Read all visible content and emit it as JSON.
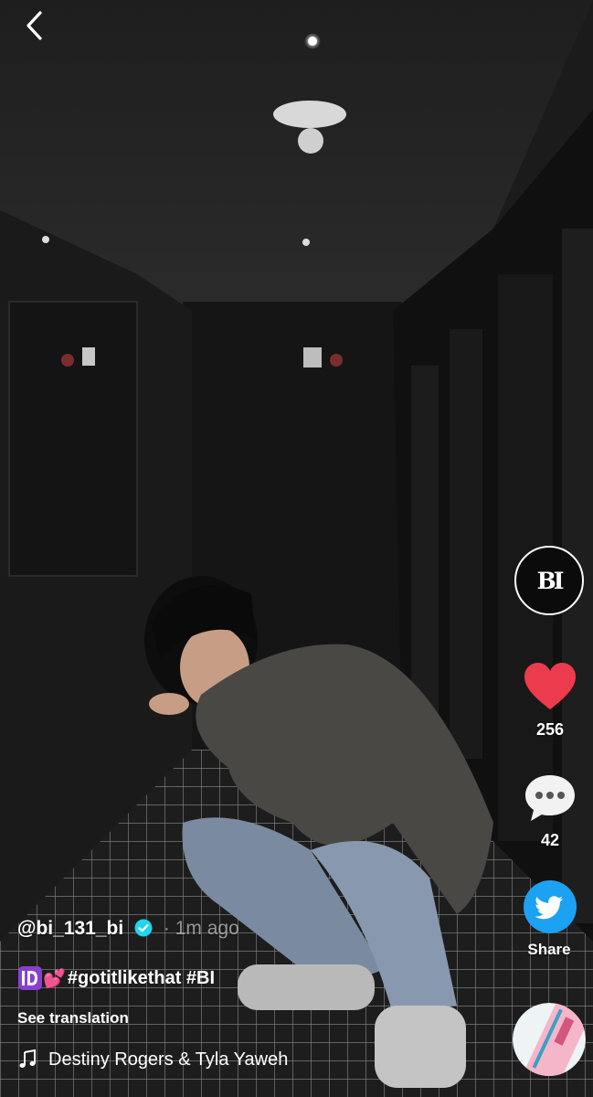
{
  "post": {
    "username": "@bi_131_bi",
    "time": "· 1m ago",
    "caption_emoji": "💕",
    "caption_tags": "#gotitlikethat #BI",
    "see_translation": "See translation",
    "music": "Destiny Rogers & Tyla Yaweh"
  },
  "sidebar": {
    "avatar_text": "BI",
    "likes": "256",
    "comments": "42",
    "share_label": "Share"
  },
  "icons": {
    "back": "chevron-left-icon",
    "verified": "verified-badge-icon",
    "id": "id-emoji-icon",
    "like": "heart-icon",
    "comment": "comment-bubble-icon",
    "share": "twitter-icon",
    "music": "music-note-icon",
    "disc": "music-disc-icon"
  },
  "colors": {
    "like": "#ec3b4d",
    "verified": "#20d5ec",
    "share": "#1da1f2",
    "id_emoji": "#8a3fd1"
  }
}
